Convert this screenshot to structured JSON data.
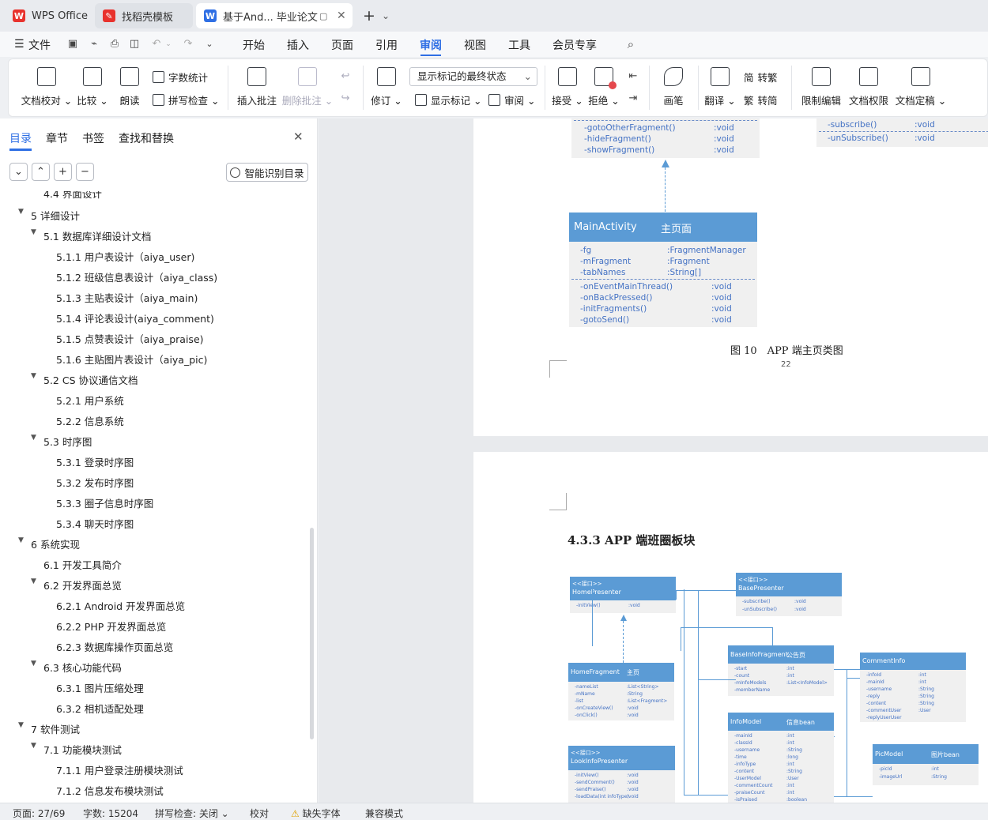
{
  "tabs": {
    "wps": "WPS Office",
    "template": "找稻壳模板",
    "doc": "基于And... 毕业论文"
  },
  "menu": {
    "file": "文件",
    "items": [
      "开始",
      "插入",
      "页面",
      "引用",
      "审阅",
      "视图",
      "工具",
      "会员专享"
    ]
  },
  "ribbon": {
    "doc_check": "文档校对",
    "compare": "比较",
    "read_aloud": "朗读",
    "word_count": "字数统计",
    "spell_check": "拼写检查",
    "insert_comment": "插入批注",
    "delete_comment": "删除批注",
    "track": "修订",
    "markup_state": "显示标记的最终状态",
    "show_markup": "显示标记",
    "review": "审阅",
    "accept": "接受",
    "reject": "拒绝",
    "pen": "画笔",
    "translate": "翻译",
    "to_trad": "转繁",
    "to_simp": "转简",
    "restrict": "限制编辑",
    "doc_perm": "文档权限",
    "finalize": "文档定稿"
  },
  "sidebar": {
    "tabs": [
      "目录",
      "章节",
      "书签",
      "查找和替换"
    ],
    "ai_button": "智能识别目录",
    "toc": [
      {
        "num": "4.4",
        "text": "界面设计",
        "level": 2,
        "partial": true
      },
      {
        "num": "5",
        "text": "详细设计",
        "level": 1,
        "open": true
      },
      {
        "num": "5.1",
        "text": "数据库详细设计文档",
        "level": 2,
        "open": true
      },
      {
        "num": "5.1.1",
        "text": "用户表设计（aiya_user)",
        "level": 3
      },
      {
        "num": "5.1.2",
        "text": "班级信息表设计（aiya_class)",
        "level": 3
      },
      {
        "num": "5.1.3",
        "text": "主贴表设计（aiya_main)",
        "level": 3
      },
      {
        "num": "5.1.4",
        "text": "评论表设计(aiya_comment)",
        "level": 3
      },
      {
        "num": "5.1.5",
        "text": "点赞表设计（aiya_praise)",
        "level": 3
      },
      {
        "num": "5.1.6",
        "text": "主贴图片表设计（aiya_pic)",
        "level": 3
      },
      {
        "num": "5.2",
        "text": "CS 协议通信文档",
        "level": 2,
        "open": true
      },
      {
        "num": "5.2.1",
        "text": "用户系统",
        "level": 3
      },
      {
        "num": "5.2.2",
        "text": "信息系统",
        "level": 3
      },
      {
        "num": "5.3",
        "text": "时序图",
        "level": 2,
        "open": true
      },
      {
        "num": "5.3.1",
        "text": "登录时序图",
        "level": 3
      },
      {
        "num": "5.3.2",
        "text": "发布时序图",
        "level": 3
      },
      {
        "num": "5.3.3",
        "text": "圈子信息时序图",
        "level": 3
      },
      {
        "num": "5.3.4",
        "text": "聊天时序图",
        "level": 3
      },
      {
        "num": "6",
        "text": "系统实现",
        "level": 1,
        "open": true
      },
      {
        "num": "6.1",
        "text": "开发工具简介",
        "level": 2
      },
      {
        "num": "6.2",
        "text": "开发界面总览",
        "level": 2,
        "open": true
      },
      {
        "num": "6.2.1",
        "text": "Android 开发界面总览",
        "level": 3
      },
      {
        "num": "6.2.2",
        "text": "PHP 开发界面总览",
        "level": 3
      },
      {
        "num": "6.2.3",
        "text": "数据库操作页面总览",
        "level": 3
      },
      {
        "num": "6.3",
        "text": "核心功能代码",
        "level": 2,
        "open": true
      },
      {
        "num": "6.3.1",
        "text": "图片压缩处理",
        "level": 3
      },
      {
        "num": "6.3.2",
        "text": "相机适配处理",
        "level": 3
      },
      {
        "num": "7",
        "text": "软件测试",
        "level": 1,
        "open": true
      },
      {
        "num": "7.1",
        "text": "功能模块测试",
        "level": 2,
        "open": true
      },
      {
        "num": "7.1.1",
        "text": "用户登录注册模块测试",
        "level": 3
      },
      {
        "num": "7.1.2",
        "text": "信息发布模块测试",
        "level": 3
      }
    ]
  },
  "page1": {
    "top_left_methods": [
      {
        "name": "-gotoOtherFragment()",
        "type": ":void"
      },
      {
        "name": "-hideFragment()",
        "type": ":void"
      },
      {
        "name": "-showFragment()",
        "type": ":void"
      }
    ],
    "top_right_methods": [
      {
        "name": "-subscribe()",
        "type": ":void"
      },
      {
        "name": "-unSubscribe()",
        "type": ":void"
      }
    ],
    "main_activity": {
      "name": "MainActivity",
      "cn": "主页面",
      "fields": [
        {
          "name": "-fg",
          "type": ":FragmentManager"
        },
        {
          "name": "-mFragment",
          "type": ":Fragment"
        },
        {
          "name": "-tabNames",
          "type": ":String[]"
        }
      ],
      "methods": [
        {
          "name": "-onEventMainThread()",
          "type": ":void"
        },
        {
          "name": "-onBackPressed()",
          "type": ":void"
        },
        {
          "name": "-initFragments()",
          "type": ":void"
        },
        {
          "name": "-gotoSend()",
          "type": ":void"
        }
      ]
    },
    "caption": "图 10　APP 端主页类图",
    "page_number": "22"
  },
  "page2": {
    "heading": "4.3.3  APP 端班圈板块",
    "classes": {
      "home_presenter": {
        "stereo": "<<接口>>",
        "name": "HomePresenter",
        "rows": [
          {
            "name": "-initView()",
            "type": ":void"
          }
        ]
      },
      "base_presenter": {
        "stereo": "<<接口>>",
        "name": "BasePresenter",
        "rows": [
          {
            "name": "-subscribe()",
            "type": ":void"
          },
          {
            "name": "-unSubscribe()",
            "type": ":void"
          }
        ]
      },
      "base_info_fragment": {
        "name": "BaseInfoFragment",
        "cn": "公告页",
        "rows": [
          {
            "name": "-start",
            "type": ":int"
          },
          {
            "name": "-count",
            "type": ":int"
          },
          {
            "name": "-mInfoModels",
            "type": ":List<InfoModel>"
          },
          {
            "name": "-memberName",
            "type": ""
          }
        ]
      },
      "home_fragment": {
        "name": "HomeFragment",
        "cn": "主页",
        "rows": [
          {
            "name": "-nameList",
            "type": ":List<String>"
          },
          {
            "name": "-mName",
            "type": ":String"
          },
          {
            "name": "-list",
            "type": ":List<Fragment>"
          },
          {
            "name": "-onCreateView()",
            "type": ":void"
          },
          {
            "name": "-onClick()",
            "type": ":void"
          }
        ]
      },
      "comment_info": {
        "name": "CommentInfo",
        "rows": [
          {
            "name": "-infoId",
            "type": ":int"
          },
          {
            "name": "-mainId",
            "type": ":int"
          },
          {
            "name": "-username",
            "type": ":String"
          },
          {
            "name": "-reply",
            "type": ":String"
          },
          {
            "name": "-content",
            "type": ":String"
          },
          {
            "name": "-commentUser",
            "type": ":User"
          },
          {
            "name": "-replyUserUser",
            "type": ""
          }
        ]
      },
      "info_model": {
        "name": "InfoModel",
        "cn": "信息bean",
        "rows": [
          {
            "name": "-mainId",
            "type": ":int"
          },
          {
            "name": "-classId",
            "type": ":int"
          },
          {
            "name": "-username",
            "type": ":String"
          },
          {
            "name": "-time",
            "type": ":long"
          },
          {
            "name": "-infoType",
            "type": ":int"
          },
          {
            "name": "-content",
            "type": ":String"
          },
          {
            "name": "-UserModel",
            "type": ":User"
          },
          {
            "name": "-commentCount",
            "type": ":int"
          },
          {
            "name": "-praiseCount",
            "type": ":int"
          },
          {
            "name": "-isPraised",
            "type": ":boolean"
          }
        ]
      },
      "look_info_presenter": {
        "stereo": "<<接口>>",
        "name": "LookInfoPresenter",
        "rows": [
          {
            "name": "-initView()",
            "type": ":void"
          },
          {
            "name": "-sendComment()",
            "type": ":void"
          },
          {
            "name": "-sendPraise()",
            "type": ":void"
          },
          {
            "name": "-loadData(int infoType)",
            "type": ":void"
          }
        ]
      },
      "pic_model": {
        "name": "PicModel",
        "cn": "图片bean",
        "rows": [
          {
            "name": "-picId",
            "type": ":int"
          },
          {
            "name": "-imageUrl",
            "type": ":String"
          }
        ]
      }
    }
  },
  "status": {
    "page": "页面: 27/69",
    "words": "字数: 15204",
    "spell": "拼写检查: 关闭",
    "proof": "校对",
    "missing_font": "缺失字体",
    "compat": "兼容模式"
  },
  "colors": {
    "accent": "#2f6fe4",
    "uml_header": "#5b9bd5",
    "uml_text": "#4472c4",
    "wps_red": "#e8322d"
  }
}
